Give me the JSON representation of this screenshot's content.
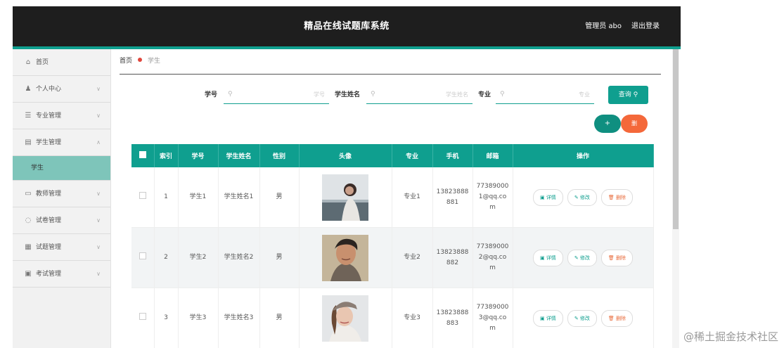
{
  "header": {
    "title": "精品在线试题库系统",
    "admin": "管理员 abo",
    "logout": "退出登录"
  },
  "sidebar": {
    "items": [
      {
        "label": "首页",
        "icon": "home-icon"
      },
      {
        "label": "个人中心",
        "icon": "user-icon"
      },
      {
        "label": "专业管理",
        "icon": "list-icon"
      },
      {
        "label": "学生管理",
        "icon": "building-icon",
        "expanded": true
      },
      {
        "label": "教师管理",
        "icon": "id-card-icon"
      },
      {
        "label": "试卷管理",
        "icon": "circle-icon"
      },
      {
        "label": "试题管理",
        "icon": "table-icon"
      },
      {
        "label": "考试管理",
        "icon": "document-icon"
      }
    ],
    "sub_item": "学生"
  },
  "breadcrumb": {
    "home": "首页",
    "current": "学生"
  },
  "search": {
    "fields": [
      {
        "label": "学号",
        "placeholder": "学号"
      },
      {
        "label": "学生姓名",
        "placeholder": "学生姓名"
      },
      {
        "label": "专业",
        "placeholder": "专业"
      }
    ],
    "query_label": "查询",
    "add_label": "+",
    "delete_label": "删"
  },
  "table": {
    "headers": [
      "索引",
      "学号",
      "学生姓名",
      "性别",
      "头像",
      "专业",
      "手机",
      "邮箱",
      "操作"
    ],
    "rows": [
      {
        "index": "1",
        "id": "学生1",
        "name": "学生姓名1",
        "gender": "男",
        "major": "专业1",
        "phone": [
          "13823888",
          "881"
        ],
        "email": [
          "77389000",
          "1@qq.co",
          "m"
        ]
      },
      {
        "index": "2",
        "id": "学生2",
        "name": "学生姓名2",
        "gender": "男",
        "major": "专业2",
        "phone": [
          "13823888",
          "882"
        ],
        "email": [
          "77389000",
          "2@qq.co",
          "m"
        ]
      },
      {
        "index": "3",
        "id": "学生3",
        "name": "学生姓名3",
        "gender": "男",
        "major": "专业3",
        "phone": [
          "13823888",
          "883"
        ],
        "email": [
          "77389000",
          "3@qq.co",
          "m"
        ]
      }
    ],
    "ops": {
      "detail": "详情",
      "edit": "修改",
      "delete": "删除"
    }
  },
  "watermark": "@稀土掘金技术社区",
  "colors": {
    "accent": "#0f9f8f",
    "danger": "#f4683a",
    "header_bg": "#1e1e1e"
  }
}
